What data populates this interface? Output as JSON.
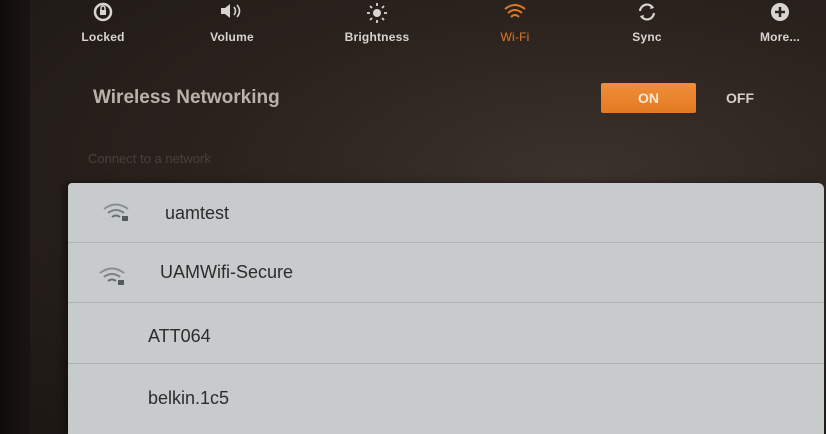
{
  "quick_settings": [
    {
      "label": "Locked",
      "icon": "lock-rotation-icon",
      "active": false
    },
    {
      "label": "Volume",
      "icon": "volume-icon",
      "active": false
    },
    {
      "label": "Brightness",
      "icon": "brightness-icon",
      "active": false
    },
    {
      "label": "Wi-Fi",
      "icon": "wifi-icon",
      "active": true
    },
    {
      "label": "Sync",
      "icon": "sync-icon",
      "active": false
    },
    {
      "label": "More...",
      "icon": "plus-icon",
      "active": false
    }
  ],
  "wireless": {
    "title": "Wireless Networking",
    "on_label": "ON",
    "off_label": "OFF",
    "state": "on"
  },
  "connect_label": "Connect to a network",
  "networks": [
    {
      "name": "uamtest",
      "secured": true
    },
    {
      "name": "UAMWifi-Secure",
      "secured": true
    },
    {
      "name": "ATT064",
      "secured": false
    },
    {
      "name": "belkin.1c5",
      "secured": false
    }
  ],
  "colors": {
    "accent": "#e37a22",
    "list_bg": "#c7cbcc",
    "background": "#2a221d"
  }
}
